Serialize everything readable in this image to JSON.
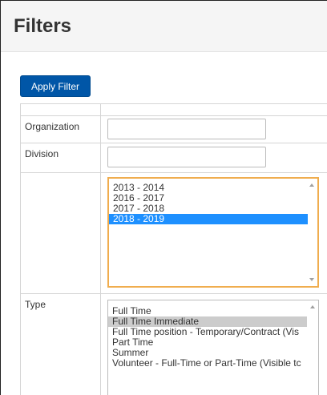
{
  "header": {
    "title": "Filters"
  },
  "toolbar": {
    "apply_label": "Apply Filter"
  },
  "filters": {
    "organization": {
      "label": "Organization",
      "value": ""
    },
    "division": {
      "label": "Division",
      "value": ""
    },
    "year": {
      "label": "",
      "options": [
        "2013 - 2014",
        "2016 - 2017",
        "2017 - 2018",
        "2018 - 2019"
      ],
      "selected": "2018 - 2019"
    },
    "type": {
      "label": "Type",
      "options": [
        "Full Time",
        "Full Time Immediate",
        "Full Time position - Temporary/Contract (Vis",
        "Part Time",
        "Summer",
        "Volunteer - Full-Time or Part-Time (Visible tc"
      ],
      "selected": "Full Time Immediate"
    }
  },
  "colors": {
    "primary_button": "#0056a7",
    "focus_border": "#f0ad4e",
    "selected_option": "#1e90ff",
    "inactive_selection": "#cccccc"
  }
}
